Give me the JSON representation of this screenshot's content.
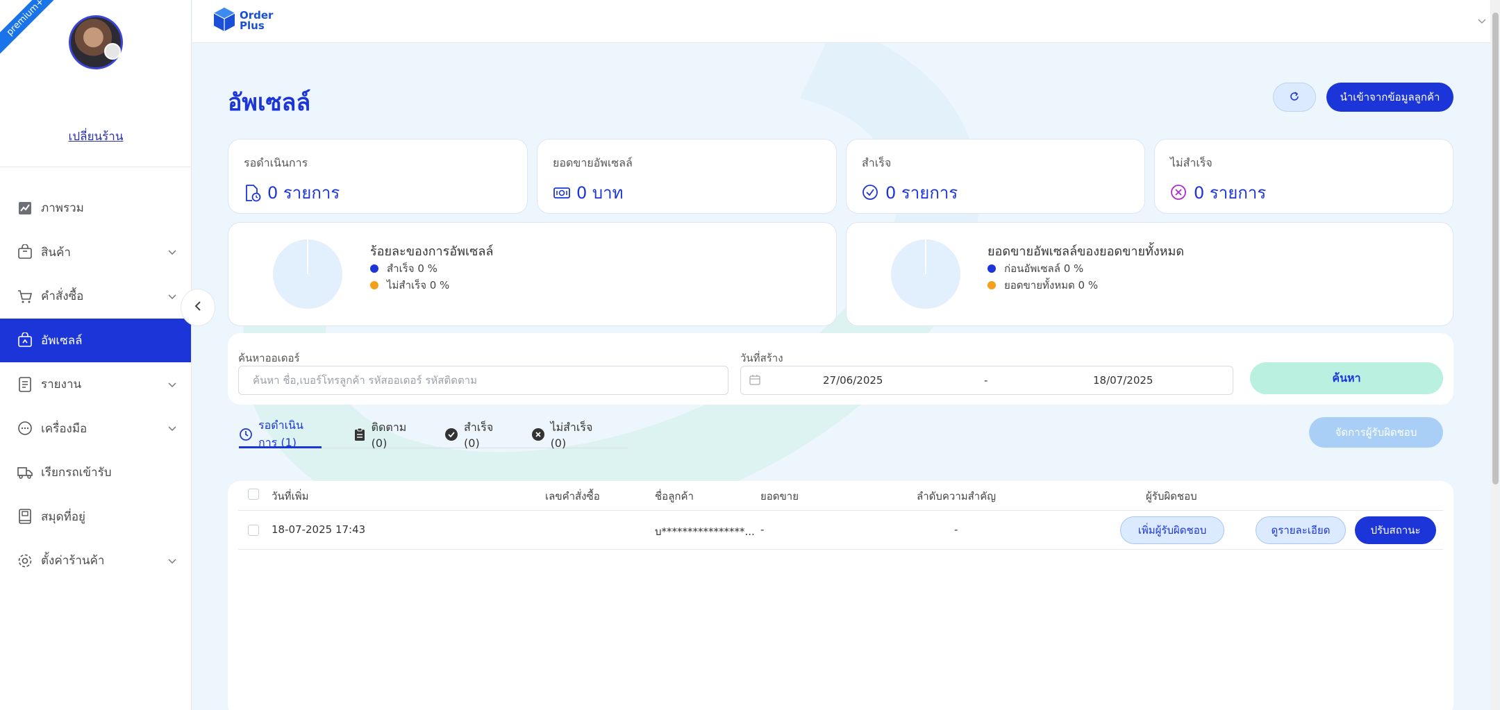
{
  "sidebar": {
    "badge": "premium+",
    "change_shop": "เปลี่ยนร้าน",
    "items": [
      {
        "label": "ภาพรวม"
      },
      {
        "label": "สินค้า"
      },
      {
        "label": "คำสั่งซื้อ"
      },
      {
        "label": "อัพเซลล์"
      },
      {
        "label": "รายงาน"
      },
      {
        "label": "เครื่องมือ"
      },
      {
        "label": "เรียกรถเข้ารับ"
      },
      {
        "label": "สมุดที่อยู่"
      },
      {
        "label": "ตั้งค่าร้านค้า"
      }
    ]
  },
  "header": {
    "logo_line1": "Order",
    "logo_line2": "Plus"
  },
  "page": {
    "title": "อัพเซลล์",
    "import_button": "นำเข้าจากข้อมูลลูกค้า"
  },
  "stats": [
    {
      "label": "รอดำเนินการ",
      "value": "0 รายการ"
    },
    {
      "label": "ยอดขายอัพเซลล์",
      "value": "0 บาท"
    },
    {
      "label": "สำเร็จ",
      "value": "0 รายการ"
    },
    {
      "label": "ไม่สำเร็จ",
      "value": "0 รายการ"
    }
  ],
  "pies": [
    {
      "title": "ร้อยละของการอัพเซลล์",
      "legend": [
        "สำเร็จ 0 %",
        "ไม่สำเร็จ 0 %"
      ]
    },
    {
      "title": "ยอดขายอัพเซลล์ของยอดขายทั้งหมด",
      "legend": [
        "ก่อนอัพเซลล์ 0 %",
        "ยอดขายทั้งหมด 0 %"
      ]
    }
  ],
  "colors": {
    "primary": "#1c35d9",
    "success_dot": "#1c35d9",
    "fail_dot": "#f5a01a"
  },
  "filter": {
    "search_label": "ค้นหาออเดอร์",
    "search_placeholder": "ค้นหา ชื่อ,เบอร์โทรลูกค้า รหัสออเดอร์ รหัสติดตาม",
    "date_label": "วันที่สร้าง",
    "date_from": "27/06/2025",
    "date_sep": "-",
    "date_to": "18/07/2025",
    "search_button": "ค้นหา"
  },
  "tabs": [
    {
      "label": "รอดำเนินการ (1)"
    },
    {
      "label": "ติดตาม (0)"
    },
    {
      "label": "สำเร็จ (0)"
    },
    {
      "label": "ไม่สำเร็จ (0)"
    }
  ],
  "manage_button": "จัดการผู้รับผิดชอบ",
  "table": {
    "columns": [
      "วันที่เพิ่ม",
      "เลขคำสั่งซื้อ",
      "ชื่อลูกค้า",
      "ยอดขาย",
      "ลำดับความสำคัญ",
      "ผู้รับผิดชอบ"
    ],
    "rows": [
      {
        "date": "18-07-2025 17:43",
        "order_no": "",
        "customer": "บ****************...",
        "sales": "-",
        "priority": "-",
        "add_owner": "เพิ่มผู้รับผิดชอบ",
        "view_detail": "ดูรายละเอียด",
        "update_status": "ปรับสถานะ"
      }
    ]
  }
}
